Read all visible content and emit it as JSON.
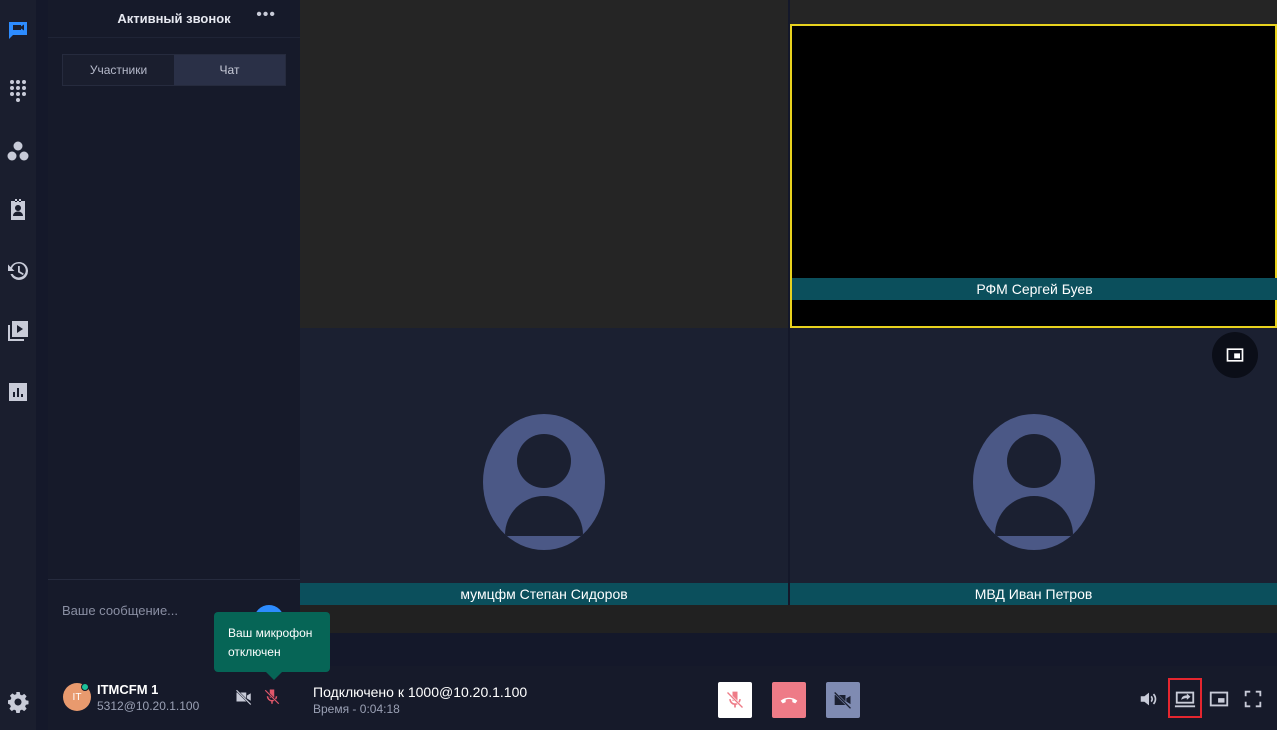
{
  "panel": {
    "title": "Активный звонок",
    "more": "•••",
    "tabs": [
      {
        "label": "Участники"
      },
      {
        "label": "Чат"
      }
    ],
    "message_placeholder": "Ваше сообщение..."
  },
  "tooltip": {
    "text": "Ваш микрофон отключен"
  },
  "participants": [
    {
      "name": "РФМ Сергей Буев"
    },
    {
      "name": "мумцфм Степан Сидоров"
    },
    {
      "name": "МВД Иван Петров"
    }
  ],
  "user": {
    "initials": "IT",
    "name": "ITMCFM 1",
    "extension": "5312@10.20.1.100"
  },
  "call": {
    "status": "Подключено к 1000@10.20.1.100",
    "time": "Время - 0:04:18"
  },
  "colors": {
    "accent": "#2d8cff",
    "active_speaker_border": "#e8d21e",
    "hangup": "#ee7b87",
    "tooltip": "#066556",
    "highlight_box": "#e4262f"
  }
}
